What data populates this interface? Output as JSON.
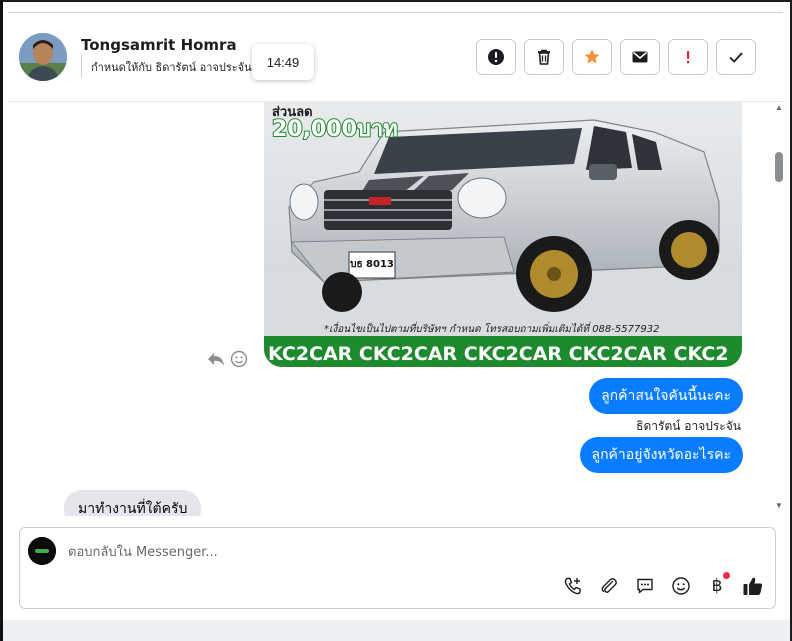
{
  "header": {
    "contact_name": "Tongsamrit Homra",
    "assigned_line": "กำหนดให้กับ ธิดารัตน์ อาจประจัน",
    "tooltip_time": "14:49",
    "actions": [
      {
        "name": "mark-spam",
        "icon": "exclamation-circle-icon"
      },
      {
        "name": "delete",
        "icon": "trash-icon"
      },
      {
        "name": "star",
        "icon": "star-icon",
        "color": "#f7923a"
      },
      {
        "name": "mark-unread",
        "icon": "envelope-icon"
      },
      {
        "name": "follow-up",
        "icon": "exclamation-icon",
        "color": "#e41e3f"
      },
      {
        "name": "mark-done",
        "icon": "check-icon"
      }
    ]
  },
  "messages": {
    "image": {
      "price_text_top": "ส่วนลด",
      "price_text": "20,000บาท",
      "plate_text": "บธ 8013",
      "caption": "*เงื่อนไขเป็นไปตามที่บริษัทฯ กำหนด โทรสอบถามเพิ่มเติมได้ที่ 088-5577932",
      "banner": "KC2CAR CKC2CAR CKC2CAR CKC2CAR CKC2"
    },
    "outgoing": [
      {
        "text": "ลูกค้าสนใจคันนี้นะคะ"
      },
      {
        "text": "ลูกค้าอยู่จังหวัดอะไรคะ"
      }
    ],
    "sender_label": "ธิดารัตน์ อาจประจัน",
    "incoming": [
      {
        "text": "มาทำงานที่ใต้ครับ"
      }
    ]
  },
  "composer": {
    "placeholder": "ตอบกลับใน Messenger...",
    "currency_symbol": "฿",
    "icons": [
      "add-call-icon",
      "attachment-icon",
      "saved-replies-icon",
      "emoji-icon",
      "payment-icon",
      "thumbs-up-icon"
    ]
  },
  "colors": {
    "accent": "#0a7cff",
    "incoming_bubble": "#e4e6eb",
    "star": "#f7923a",
    "alert": "#e41e3f",
    "banner_green": "#1e8a2e"
  }
}
